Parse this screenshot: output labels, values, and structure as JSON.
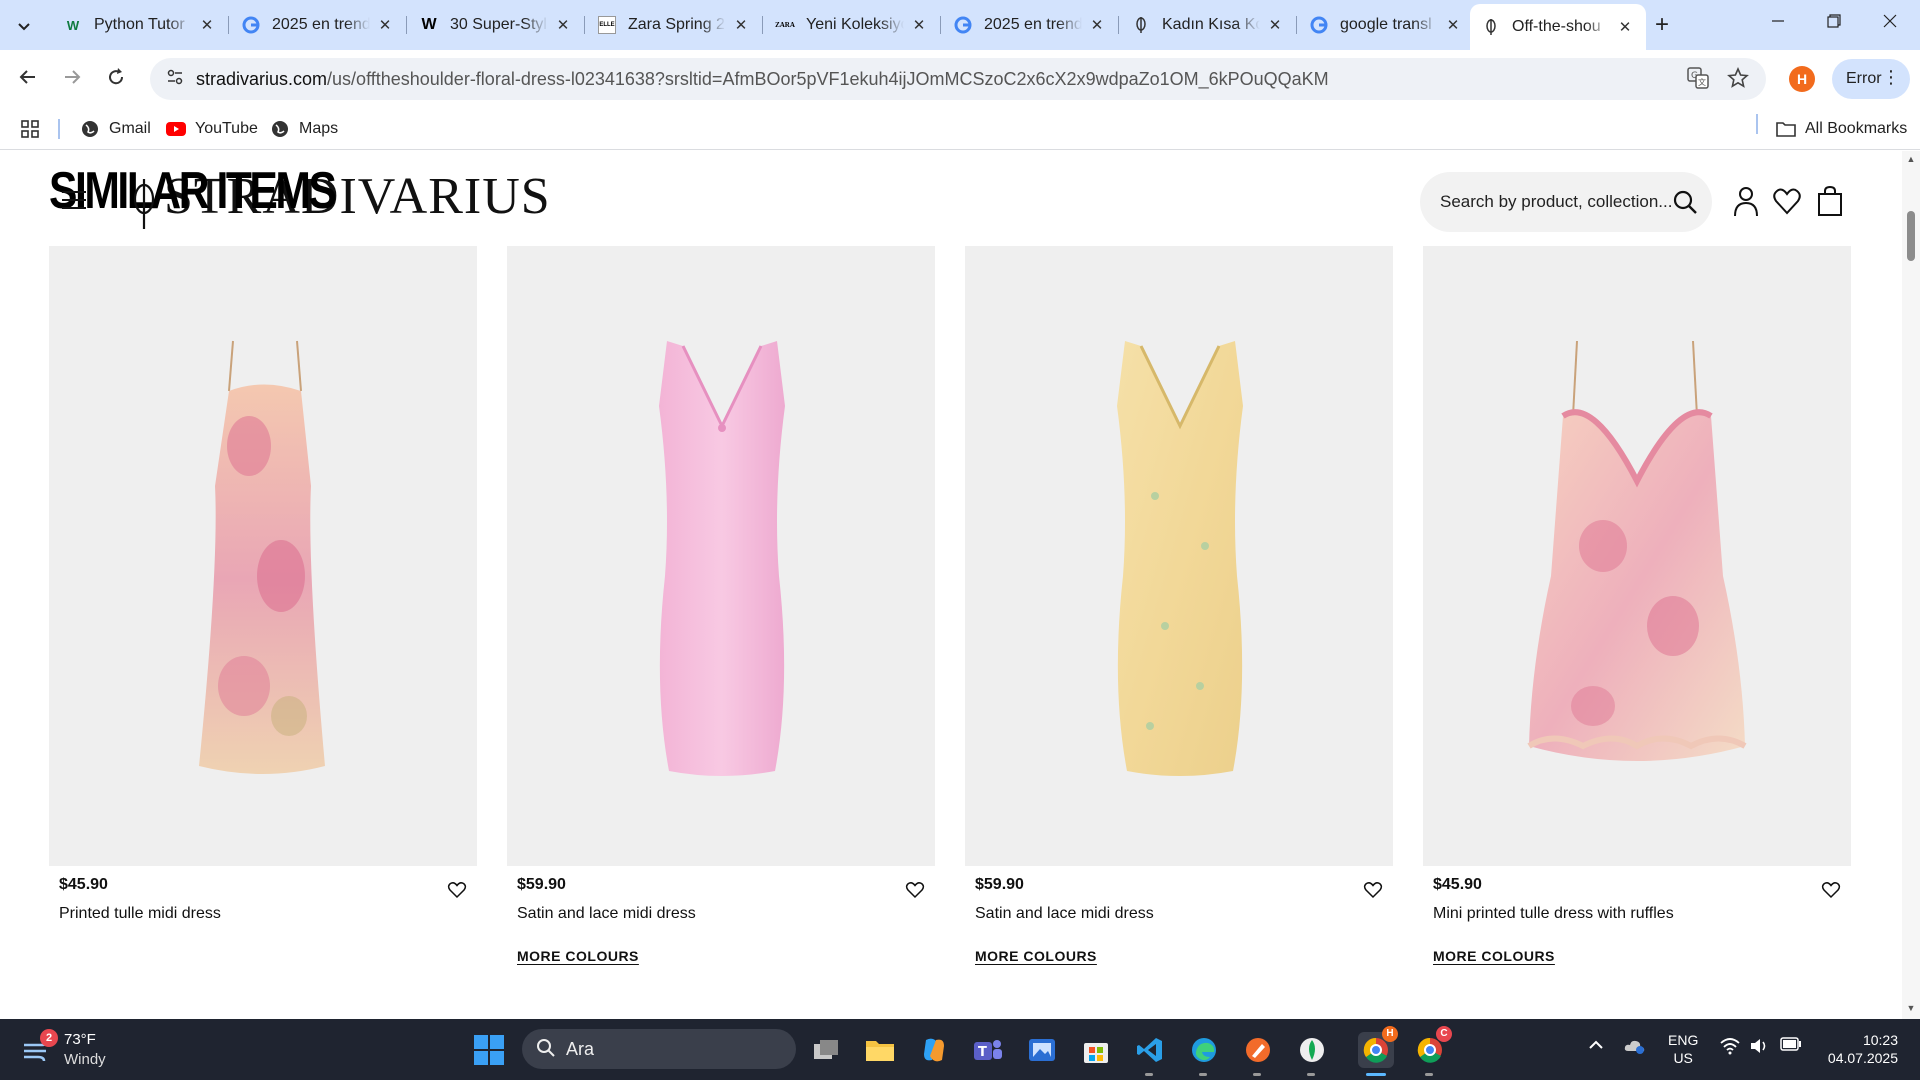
{
  "browser": {
    "tabs": [
      {
        "title": "Python Tutor",
        "favicon": "W"
      },
      {
        "title": "2025 en trend",
        "favicon": "G"
      },
      {
        "title": "30 Super-Styl",
        "favicon": "W"
      },
      {
        "title": "Zara Spring 2",
        "favicon": "ELLE"
      },
      {
        "title": "Yeni Koleksiyo",
        "favicon": "ZARA"
      },
      {
        "title": "2025 en trend",
        "favicon": "G"
      },
      {
        "title": "Kadın Kısa Ko",
        "favicon": "S"
      },
      {
        "title": "google transl",
        "favicon": "G"
      },
      {
        "title": "Off-the-shou",
        "favicon": "S"
      }
    ],
    "url_host": "stradivarius.com",
    "url_path": "/us/offtheshoulder-floral-dress-l02341638?srsltid=AfmBOor5pVF1ekuh4ijJOmMCSzoC2x6cX2x9wdpaZo1OM_6kPOuQQaKM",
    "profile_initial": "H",
    "error_label": "Error",
    "bookmarks": [
      {
        "label": "Gmail"
      },
      {
        "label": "YouTube"
      },
      {
        "label": "Maps"
      }
    ],
    "all_bookmarks_label": "All Bookmarks"
  },
  "site": {
    "section_title": "SIMILAR ITEMS",
    "brand": "STRADIVARIUS",
    "search_placeholder": "Search by product, collection..."
  },
  "products": [
    {
      "price": "$45.90",
      "name": "Printed tulle midi dress",
      "more": "",
      "color": "#f3b8c0"
    },
    {
      "price": "$59.90",
      "name": "Satin and lace midi dress",
      "more": "MORE COLOURS",
      "color": "#f5b8dc"
    },
    {
      "price": "$59.90",
      "name": "Satin and lace midi dress",
      "more": "MORE COLOURS",
      "color": "#f4dca0"
    },
    {
      "price": "$45.90",
      "name": "Mini printed tulle dress with ruffles",
      "more": "MORE COLOURS",
      "color": "#f6c0c4"
    }
  ],
  "taskbar": {
    "weather_badge": "2",
    "temperature": "73°F",
    "condition": "Windy",
    "search_text": "Ara",
    "chrome_badge_1": "H",
    "chrome_badge_2": "C",
    "lang_1": "ENG",
    "lang_2": "US",
    "time": "10:23",
    "date": "04.07.2025"
  }
}
